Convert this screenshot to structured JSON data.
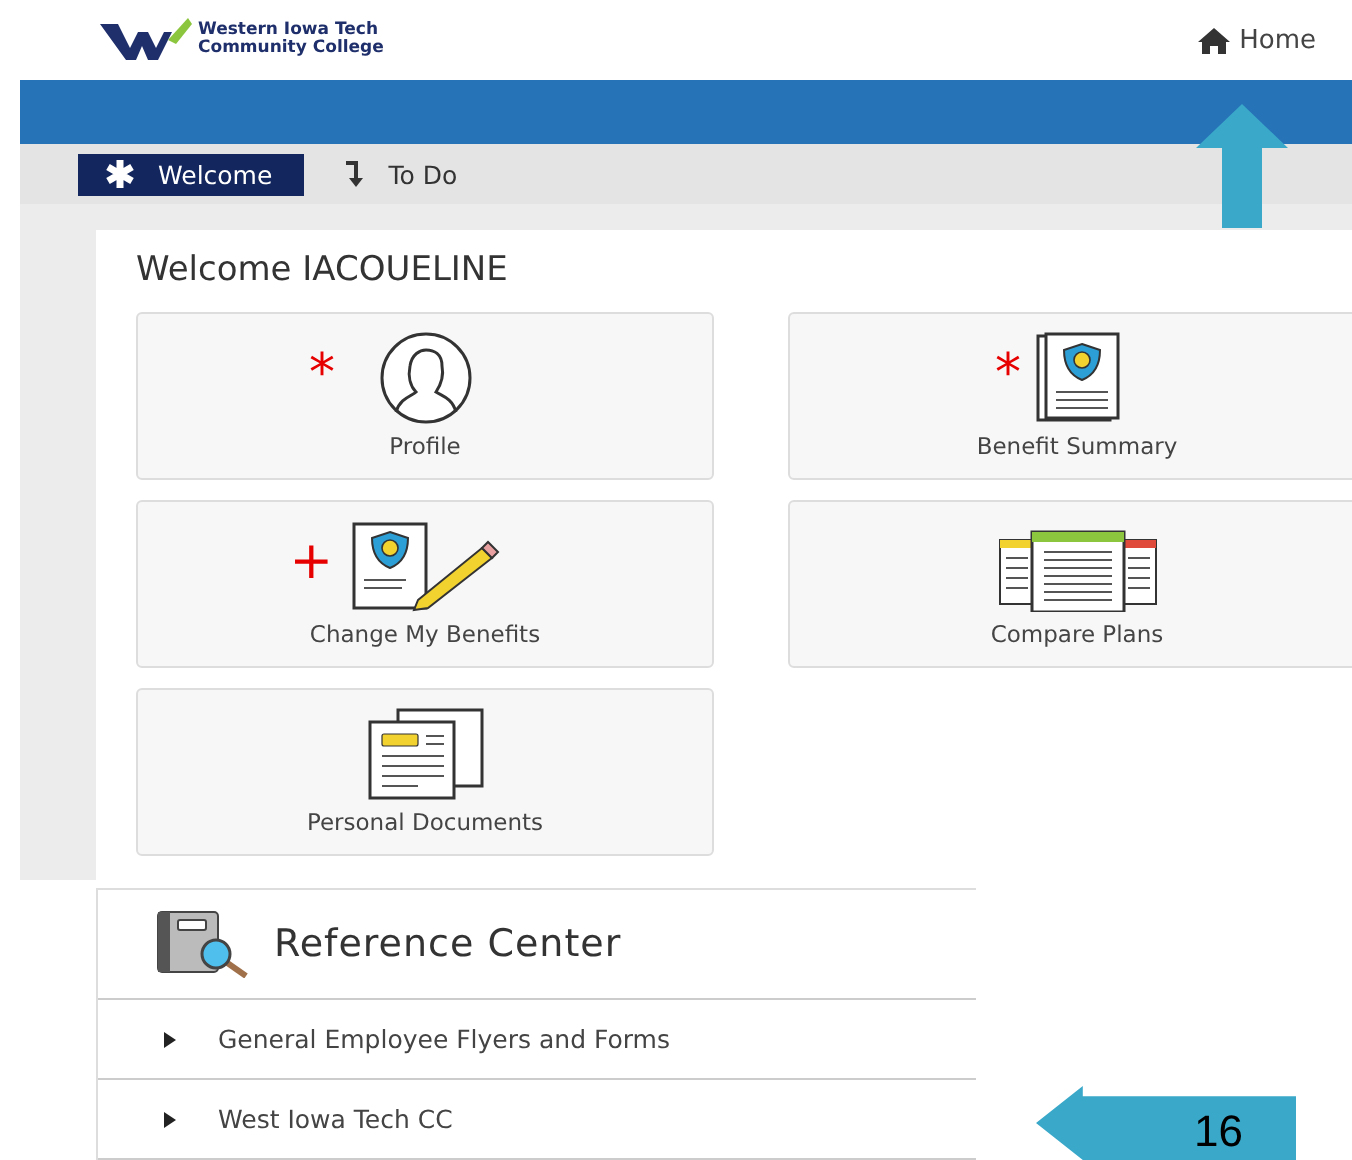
{
  "header": {
    "logo_lines": [
      "Western Iowa Tech",
      "Community College"
    ],
    "home_link": "Home"
  },
  "tabs": [
    {
      "label": "Welcome",
      "selected": true,
      "kind": "star"
    },
    {
      "label": "To Do",
      "selected": false,
      "kind": "arrow"
    }
  ],
  "welcome": {
    "title": "Welcome IACOUELINE",
    "tiles": [
      {
        "label": "Profile",
        "kind": "profile",
        "marker": "*"
      },
      {
        "label": "Benefit Summary",
        "kind": "summary",
        "marker": "*"
      },
      {
        "label": "Change My Benefits",
        "kind": "change",
        "marker": "+"
      },
      {
        "label": "Compare Plans",
        "kind": "compare"
      },
      {
        "label": "Personal Documents",
        "kind": "documents"
      }
    ]
  },
  "reference": {
    "title": "Reference Center",
    "items": [
      {
        "label": "General Employee Flyers and Forms",
        "expanded": false
      },
      {
        "label": "West Iowa Tech CC",
        "expanded": false
      }
    ]
  },
  "page_number": "16"
}
